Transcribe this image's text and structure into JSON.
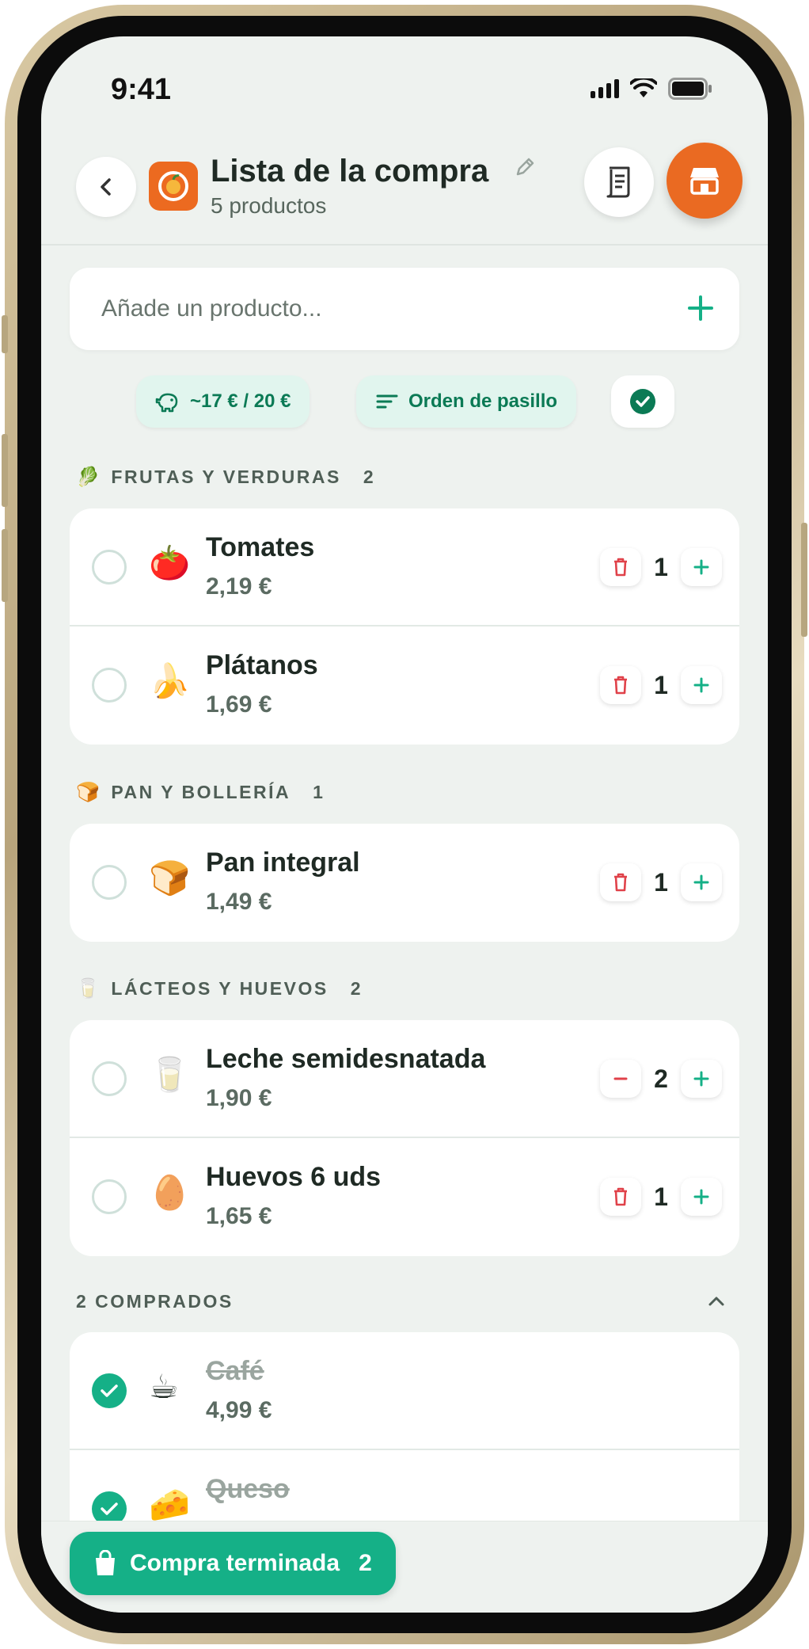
{
  "status": {
    "time": "9:41"
  },
  "header": {
    "title": "Lista de la compra",
    "subtitle": "5 productos"
  },
  "add": {
    "placeholder": "Añade un producto..."
  },
  "chips": {
    "budget": "~17 € / 20 €",
    "sort": "Orden de pasillo"
  },
  "sections": [
    {
      "emoji": "🥬",
      "title": "FRUTAS Y VERDURAS",
      "count": "2",
      "items": [
        {
          "emoji": "🍅",
          "name": "Tomates",
          "price": "2,19 €",
          "qty": "1",
          "decrement": "delete"
        },
        {
          "emoji": "🍌",
          "name": "Plátanos",
          "price": "1,69 €",
          "qty": "1",
          "decrement": "delete"
        }
      ]
    },
    {
      "emoji": "🍞",
      "title": "PAN Y BOLLERÍA",
      "count": "1",
      "items": [
        {
          "emoji": "🍞",
          "name": "Pan integral",
          "price": "1,49 €",
          "qty": "1",
          "decrement": "delete"
        }
      ]
    },
    {
      "emoji": "🥛",
      "title": "LÁCTEOS Y HUEVOS",
      "count": "2",
      "items": [
        {
          "emoji": "🥛",
          "name": "Leche semidesnatada",
          "price": "1,90 €",
          "qty": "2",
          "decrement": "minus"
        },
        {
          "emoji": "🥚",
          "name": "Huevos 6 uds",
          "price": "1,65 €",
          "qty": "1",
          "decrement": "delete"
        }
      ]
    }
  ],
  "purchased": {
    "title": "2 COMPRADOS",
    "items": [
      {
        "emoji": "☕",
        "name": "Café",
        "price": "4,99 €"
      },
      {
        "emoji": "🧀",
        "name": "Queso",
        "price": ""
      }
    ]
  },
  "footer": {
    "finish_label": "Compra terminada",
    "finish_count": "2"
  },
  "colors": {
    "accent": "#15b087",
    "brand": "#ea6a22",
    "danger": "#e0424a",
    "background": "#eef2ef"
  }
}
